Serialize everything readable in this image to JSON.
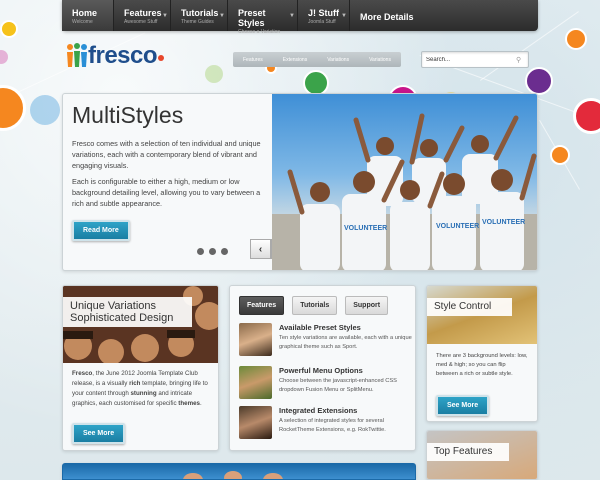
{
  "nav": {
    "items": [
      {
        "title": "Home",
        "sub": "Welcome",
        "has_arrow": false
      },
      {
        "title": "Features",
        "sub": "Awesome Stuff",
        "has_arrow": true
      },
      {
        "title": "Tutorials",
        "sub": "Theme Guides",
        "has_arrow": true
      },
      {
        "title": "Preset Styles",
        "sub": "Choose a Variation",
        "has_arrow": true
      },
      {
        "title": "J! Stuff",
        "sub": "Joomla Stuff",
        "has_arrow": true
      },
      {
        "title": "More Details",
        "sub": "",
        "has_arrow": false
      }
    ]
  },
  "logo": {
    "text": "fresco"
  },
  "submenu": [
    "Features",
    "Extensions",
    "Variations",
    "Variations"
  ],
  "search": {
    "value": "Search..."
  },
  "hero": {
    "title": "MultiStyles",
    "p1": "Fresco comes with a selection of ten individual and unique variations, each with a contemporary blend of vibrant and engaging visuals.",
    "p2": "Each is configurable to either a high, medium or low background detailing level, allowing you to vary between a rich and subtle appearance.",
    "button": "Read More",
    "prev": "‹",
    "next": "›",
    "shirt_text": "VOLUNTEER"
  },
  "unique": {
    "title_line1": "Unique Variations",
    "title_line2": "Sophisticated Design",
    "text_before": "Fresco",
    "text_1": ", the June 2012 Joomla Template Club release, is a visually ",
    "rich": "rich",
    "text_2": " template, bringing life to your content through ",
    "stunning": "stunning",
    "text_3": " and intricate graphics, each customised for specific ",
    "themes": "themes",
    "text_4": ".",
    "button": "See More"
  },
  "tabs": {
    "labels": [
      "Features",
      "Tutorials",
      "Support"
    ],
    "features": [
      {
        "title": "Available Preset Styles",
        "desc": "Ten style variations are available, each with a unique graphical theme such as Sport."
      },
      {
        "title": "Powerful Menu Options",
        "desc": "Choose between the javascript-enhanced CSS dropdown Fusion Menu or SplitMenu."
      },
      {
        "title": "Integrated Extensions",
        "desc": "A selection of integrated styles for several RocketTheme Extensions, e.g. RokTwittie."
      }
    ]
  },
  "style_control": {
    "title": "Style Control",
    "text": "There are 3 background levels: low, med & high; so you can flip between a rich or subtle style.",
    "button": "See More"
  },
  "top_features": {
    "title": "Top Features"
  },
  "colors": {
    "nav_bg": "#333333",
    "button": "#1f8bb3",
    "logo": "#1f4e8c",
    "logo_dot": "#e8472b",
    "bubble_red": "#e32a3b",
    "bubble_orange": "#f5871f",
    "bubble_purple": "#6b2d8f",
    "bubble_magenta": "#c8158a",
    "bubble_yellow": "#f6c21b",
    "bubble_blue": "#2a8fd6"
  }
}
